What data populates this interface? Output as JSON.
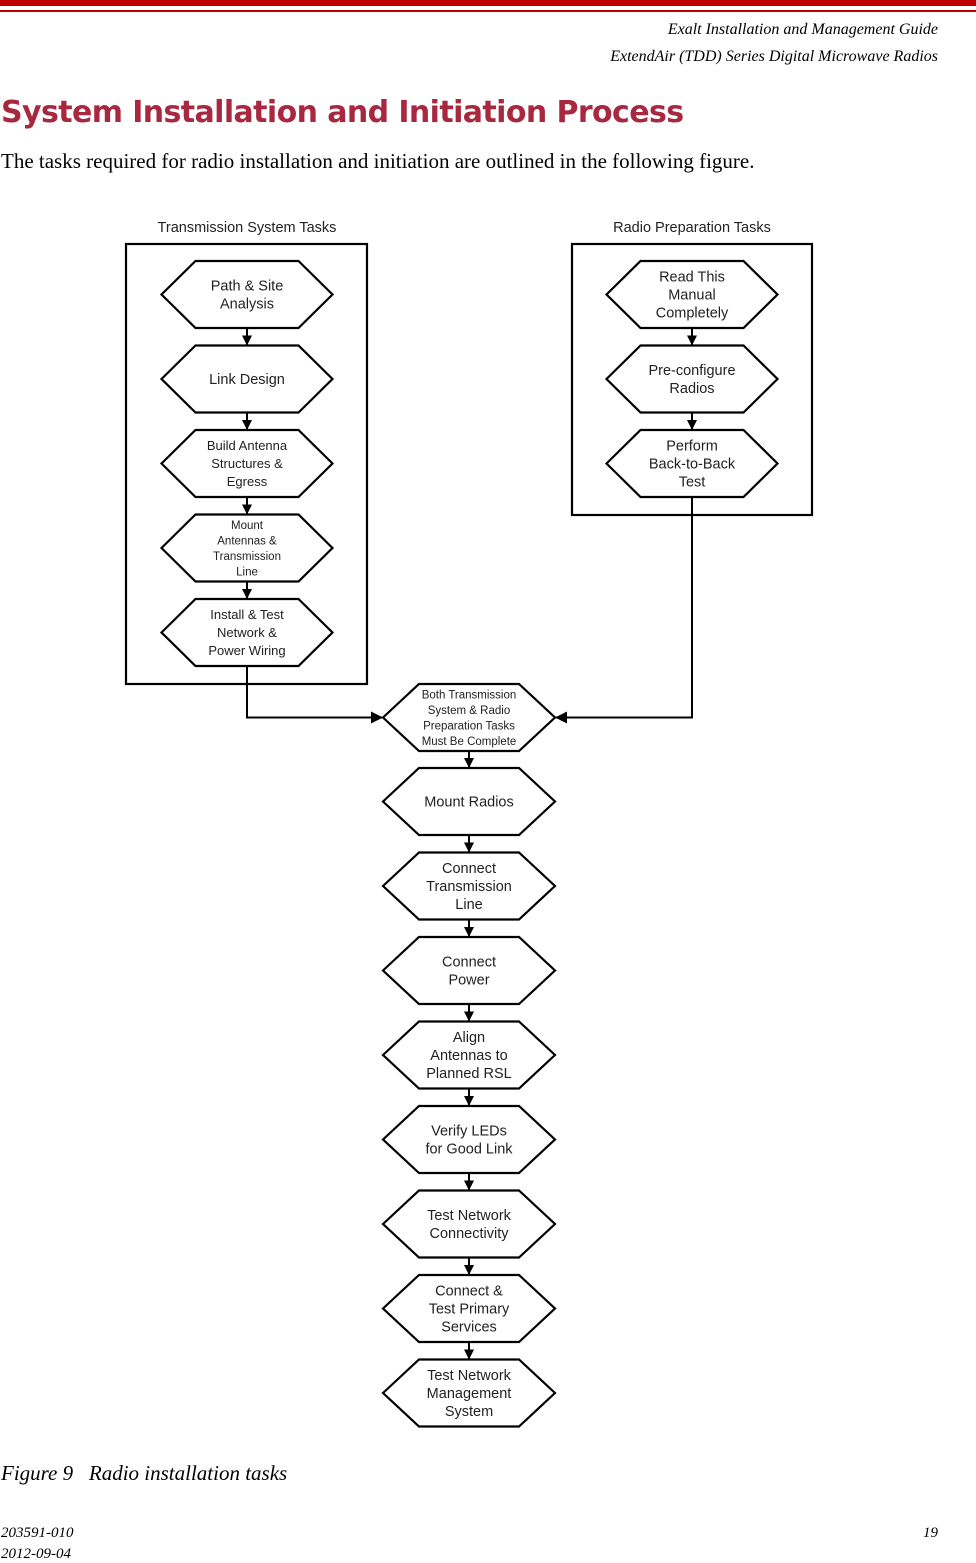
{
  "header": {
    "guide_title": "Exalt Installation and Management Guide",
    "product_line": "ExtendAir (TDD) Series Digital Microwave Radios",
    "accent_color": "#C00000"
  },
  "section": {
    "title": "System Installation and Initiation Process",
    "title_color": "#A8283F",
    "intro": "The tasks required for radio installation and initiation are outlined in the following figure."
  },
  "diagram": {
    "groups": [
      {
        "label": "Transmission System Tasks",
        "steps": [
          [
            "Path & Site",
            "Analysis"
          ],
          [
            "Link Design"
          ],
          [
            "Build Antenna",
            "Structures &",
            "Egress"
          ],
          [
            "Mount",
            "Antennas &",
            "Transmission",
            "Line"
          ],
          [
            "Install & Test",
            "Network &",
            "Power Wiring"
          ]
        ]
      },
      {
        "label": "Radio Preparation Tasks",
        "steps": [
          [
            "Read This",
            "Manual",
            "Completely"
          ],
          [
            "Pre-configure",
            "Radios"
          ],
          [
            "Perform",
            "Back-to-Back",
            "Test"
          ]
        ]
      }
    ],
    "join": [
      "Both Transmission",
      "System & Radio",
      "Preparation Tasks",
      "Must Be Complete"
    ],
    "sequence": [
      [
        "Mount Radios"
      ],
      [
        "Connect",
        "Transmission",
        "Line"
      ],
      [
        "Connect",
        "Power"
      ],
      [
        "Align",
        "Antennas to",
        "Planned RSL"
      ],
      [
        "Verify LEDs",
        "for Good Link"
      ],
      [
        "Test Network",
        "Connectivity"
      ],
      [
        "Connect &",
        "Test Primary",
        "Services"
      ],
      [
        "Test Network",
        "Management",
        "System"
      ]
    ]
  },
  "figure": {
    "caption": "Figure 9   Radio installation tasks"
  },
  "footer": {
    "doc_number": "203591-010",
    "date": "2012-09-04",
    "page_number": "19"
  }
}
